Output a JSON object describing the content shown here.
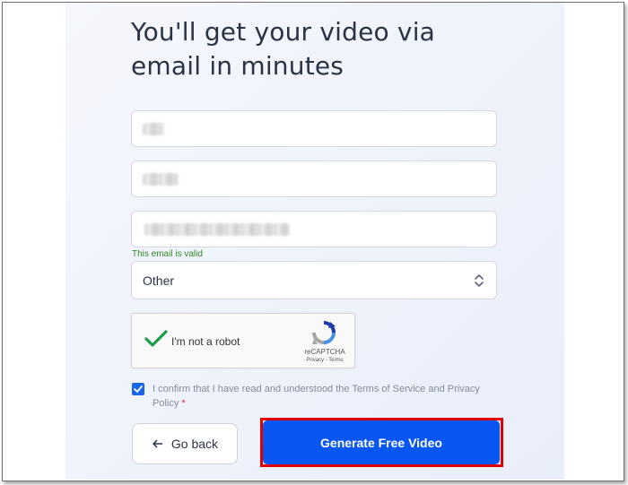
{
  "form": {
    "heading": "You'll get your video via email in minutes",
    "email_validation_message": "This email is valid",
    "role_select": {
      "selected": "Other"
    },
    "captcha": {
      "label": "I'm not a robot",
      "brand": "reCAPTCHA",
      "links": "Privacy - Terms"
    },
    "consent": {
      "checked": true,
      "text": "I confirm that I have read and understood the Terms of Service and Privacy Policy",
      "required_mark": "*"
    },
    "buttons": {
      "back_label": "Go back",
      "generate_label": "Generate Free Video"
    }
  },
  "colors": {
    "primary": "#0a56f3",
    "valid": "#2f8a23",
    "highlight": "#e00000",
    "required": "#e0243a"
  },
  "icons": {
    "back": "arrow-left-icon",
    "select": "chevron-up-down-icon",
    "captcha_check": "checkmark-icon",
    "consent": "checkbox-checked-icon"
  }
}
